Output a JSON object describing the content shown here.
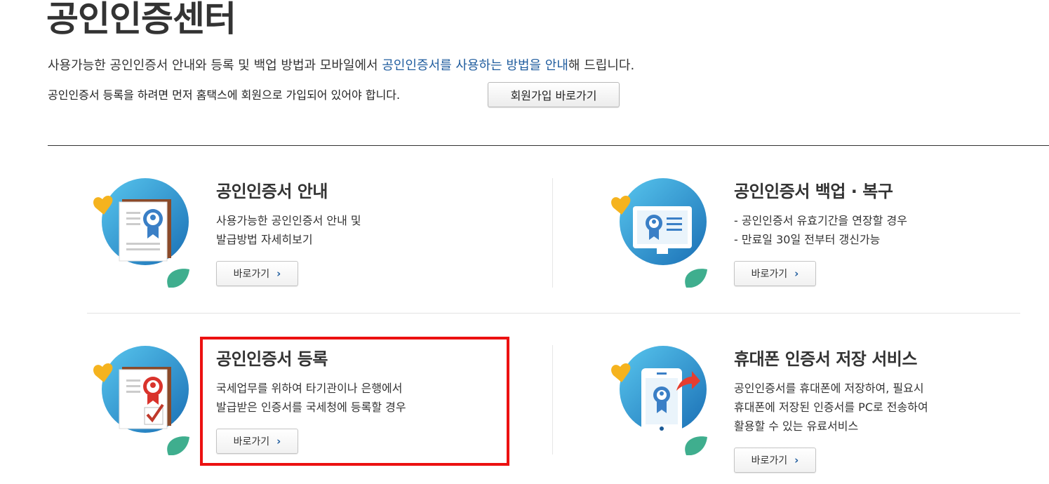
{
  "header": {
    "title": "공인인증센터",
    "intro_pre": "사용가능한 공인인증서 안내와 등록 및 백업 방법과 모바일에서 ",
    "intro_link": "공인인증서를 사용하는 방법을 안내",
    "intro_post": "해 드립니다.",
    "notice": "공인인증서 등록을 하려면 먼저 홈택스에 회원으로 가입되어 있어야 합니다.",
    "join_button": "회원가입 바로가기"
  },
  "cards": [
    {
      "title": "공인인증서 안내",
      "desc": [
        "사용가능한 공인인증서 안내 및",
        "발급방법 자세히보기"
      ],
      "button": "바로가기",
      "icon": "certificate-document-icon"
    },
    {
      "title": "공인인증서 백업 · 복구",
      "desc": [
        "- 공인인증서 유효기간을 연장할 경우",
        "- 만료일 30일 전부터 갱신가능"
      ],
      "button": "바로가기",
      "icon": "monitor-certificate-icon"
    },
    {
      "title": "공인인증서 등록",
      "desc": [
        "국세업무를 위하여 타기관이나 은행에서",
        "발급받은 인증서를 국세청에 등록할 경우"
      ],
      "button": "바로가기",
      "icon": "certificate-check-icon",
      "highlighted": true
    },
    {
      "title": "휴대폰 인증서 저장 서비스",
      "desc": [
        "공인인증서를 휴대폰에 저장하여, 필요시",
        "휴대폰에 저장된 인증서를 PC로 전송하여",
        "활용할 수 있는 유료서비스"
      ],
      "button": "바로가기",
      "icon": "phone-certificate-icon"
    }
  ],
  "colors": {
    "link_blue": "#1f5c9e",
    "highlight_red": "#ec1111",
    "circle_blue": "#2e8fcf",
    "leaf_green": "#3fae8e",
    "heart_yellow": "#f5b31e"
  }
}
